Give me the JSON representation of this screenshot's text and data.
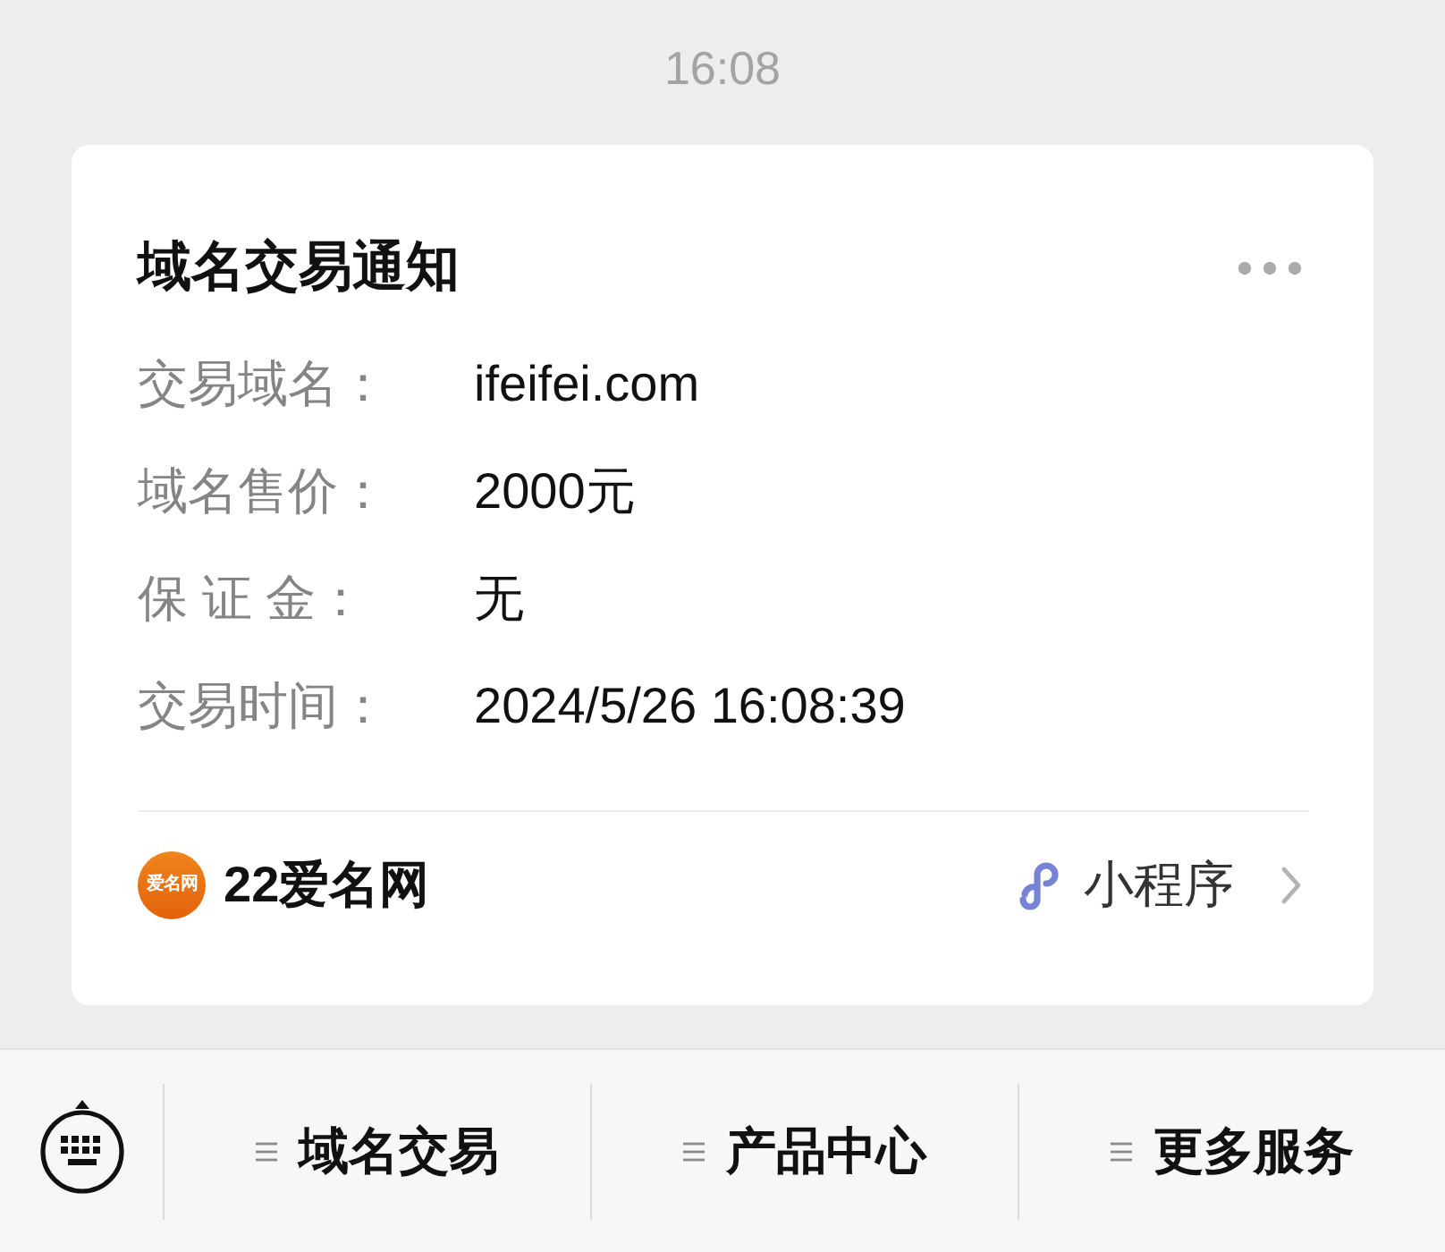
{
  "time": "16:08",
  "card": {
    "title": "域名交易通知",
    "fields": [
      {
        "label": "交易域名：",
        "value": "ifeifei.com"
      },
      {
        "label": "域名售价：",
        "value": "2000元"
      },
      {
        "label": "保 证 金：",
        "value": "无"
      },
      {
        "label": "交易时间：",
        "value": "2024/5/26 16:08:39"
      }
    ],
    "footer": {
      "logo_text": "爱名网",
      "source": "22爱名网",
      "app_label": "小程序"
    }
  },
  "menu_bar": {
    "items": [
      "域名交易",
      "产品中心",
      "更多服务"
    ]
  }
}
